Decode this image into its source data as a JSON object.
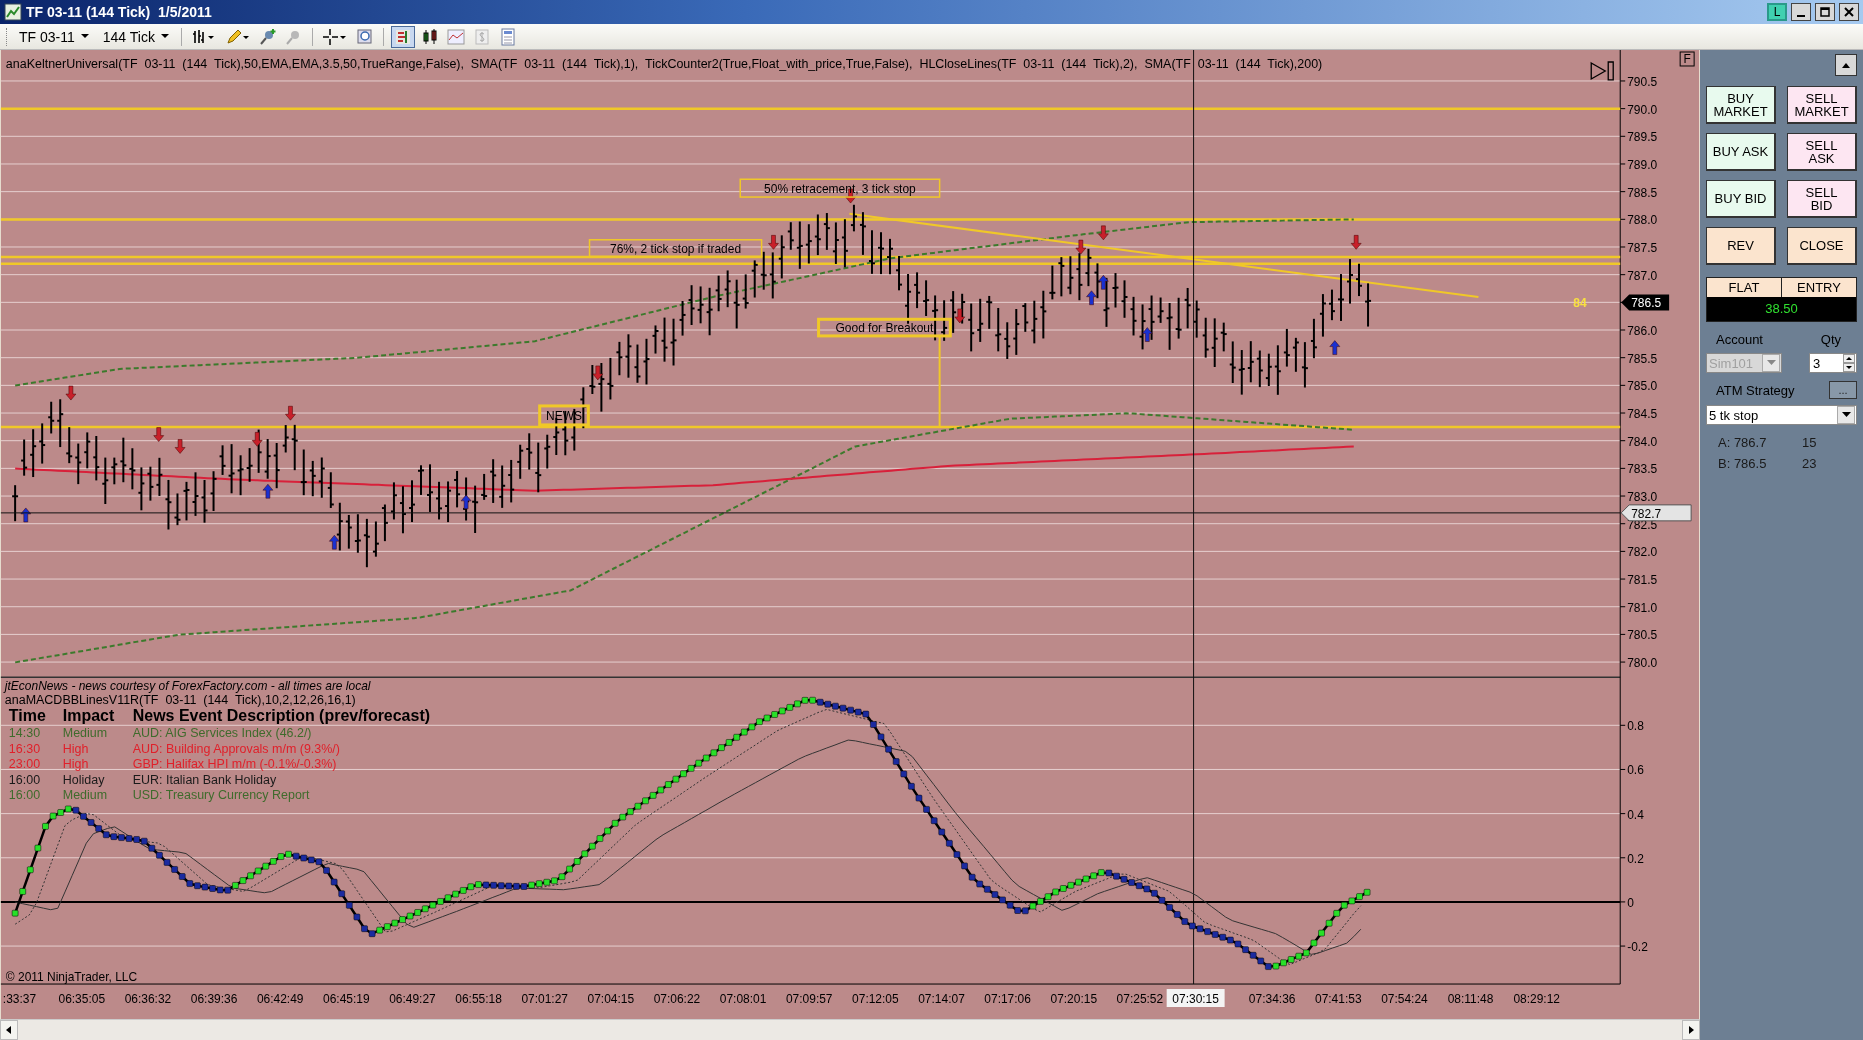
{
  "window": {
    "title": "TF 03-11 (144 Tick)  1/5/2011",
    "link_button": "L"
  },
  "toolbar": {
    "instrument": "TF 03-11",
    "interval": "144 Tick"
  },
  "chart": {
    "indicators": "anaKeltnerUniversal(TF  03-11  (144  Tick),50,EMA,EMA,3.5,50,TrueRange,False),  SMA(TF  03-11  (144  Tick),1),  TickCounter2(True,Float_with_price,True,False),  HLCloseLines(TF  03-11  (144  Tick),2),  SMA(TF  03-11  (144  Tick),200)",
    "fixed_scale_button": "F",
    "price_axis": [
      "790.5",
      "790.0",
      "789.5",
      "789.0",
      "788.5",
      "788.0",
      "787.5",
      "787.0",
      "786.0",
      "785.5",
      "785.0",
      "784.5",
      "784.0",
      "783.5",
      "783.0",
      "782.5",
      "782.0",
      "781.5",
      "781.0",
      "780.5",
      "780.0"
    ],
    "last_price": "786.5",
    "cursor_price": "782.7",
    "tick_counter": "84",
    "annotations": [
      {
        "text": "50% retracement, 3 tick stop",
        "emphasis": false
      },
      {
        "text": "76%, 2 tick stop if traded",
        "emphasis": false
      },
      {
        "text": "Good for Breakout",
        "emphasis": true
      },
      {
        "text": "NEWS",
        "emphasis": true
      }
    ],
    "news": {
      "source": "jtEconNews - news courtesy of ForexFactory.com - all times are local",
      "columns": [
        "Time",
        "Impact",
        "News Event Description (prev/forecast)"
      ],
      "rows": [
        {
          "time": "14:30",
          "impact": "Medium",
          "description": "AUD: AIG Services Index (46.2/)",
          "color": "#3f6b2c"
        },
        {
          "time": "16:30",
          "impact": "High",
          "description": "AUD: Building Approvals m/m (9.3%/)",
          "color": "#e0202a"
        },
        {
          "time": "23:00",
          "impact": "High",
          "description": "GBP: Halifax HPI m/m (-0.1%/-0.3%)",
          "color": "#e0202a"
        },
        {
          "time": "16:00",
          "impact": "Holiday",
          "description": "EUR: Italian Bank Holiday",
          "color": "#1a1a1a"
        },
        {
          "time": "16:00",
          "impact": "Medium",
          "description": "USD: Treasury Currency Report",
          "color": "#3f6b2c"
        }
      ]
    },
    "oscillator": {
      "label": "anaMACDBBLinesV11R(TF  03-11  (144  Tick),10,2,12,26,16,1)",
      "axis": [
        "0.8",
        "0.6",
        "0.4",
        "0.2",
        "0",
        "-0.2"
      ]
    },
    "copyright": "© 2011 NinjaTrader, LLC",
    "time_axis": [
      ":33:37",
      "06:35:05",
      "06:36:32",
      "06:39:36",
      "06:42:49",
      "06:45:19",
      "06:49:27",
      "06:55:18",
      "07:01:27",
      "07:04:15",
      "07:06:22",
      "07:08:01",
      "07:09:57",
      "07:12:05",
      "07:14:07",
      "07:17:06",
      "07:20:15",
      "07:25:52",
      "07:34:36",
      "07:41:53",
      "07:54:24",
      "08:11:48",
      "08:29:12"
    ],
    "cursor_time": "07:30:15"
  },
  "order_panel": {
    "buttons": [
      {
        "label": "BUY\nMARKET",
        "kind": "buy"
      },
      {
        "label": "SELL\nMARKET",
        "kind": "sell"
      },
      {
        "label": "BUY ASK",
        "kind": "buy"
      },
      {
        "label": "SELL\nASK",
        "kind": "sell"
      },
      {
        "label": "BUY BID",
        "kind": "buy"
      },
      {
        "label": "SELL\nBID",
        "kind": "sell"
      },
      {
        "label": "REV",
        "kind": "neutral"
      },
      {
        "label": "CLOSE",
        "kind": "neutral"
      }
    ],
    "position": {
      "state": "FLAT",
      "entry_label": "ENTRY",
      "pnl": "38.50"
    },
    "account": {
      "label": "Account",
      "value": "Sim101",
      "disabled": true
    },
    "quantity": {
      "label": "Qty",
      "value": "3"
    },
    "atm": {
      "label": "ATM Strategy",
      "button": "...",
      "value": "5 tk stop"
    },
    "quotes": [
      {
        "label": "A: 786.7",
        "size": "15"
      },
      {
        "label": "B: 786.5",
        "size": "23"
      }
    ]
  }
}
